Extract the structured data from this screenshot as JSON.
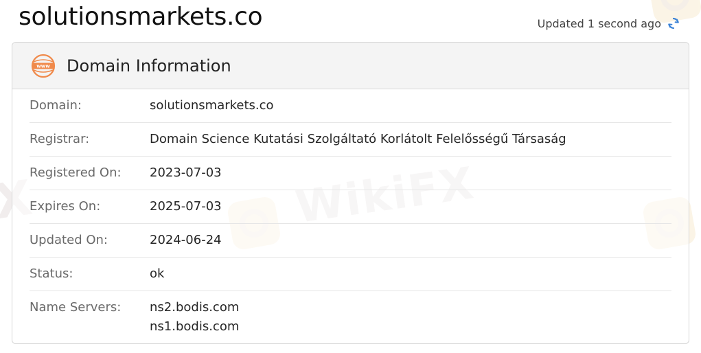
{
  "header": {
    "site_title": "solutionsmarkets.co",
    "updated_text": "Updated 1 second ago",
    "refresh_icon": "refresh-icon",
    "accent_color": "#3b82d6"
  },
  "card": {
    "title": "Domain Information",
    "icon": "www-globe-icon",
    "icon_color": "#f08a4b",
    "rows": [
      {
        "label": "Domain:",
        "value": "solutionsmarkets.co"
      },
      {
        "label": "Registrar:",
        "value": "Domain Science Kutatási Szolgáltató Korlátolt Felelősségű Társaság"
      },
      {
        "label": "Registered On:",
        "value": "2023-07-03"
      },
      {
        "label": "Expires On:",
        "value": "2025-07-03"
      },
      {
        "label": "Updated On:",
        "value": "2024-06-24"
      },
      {
        "label": "Status:",
        "value": "ok"
      },
      {
        "label": "Name Servers:",
        "values": [
          "ns2.bodis.com",
          "ns1.bodis.com"
        ]
      }
    ]
  },
  "watermark": {
    "text": "WikiFX",
    "fragment": "X"
  }
}
